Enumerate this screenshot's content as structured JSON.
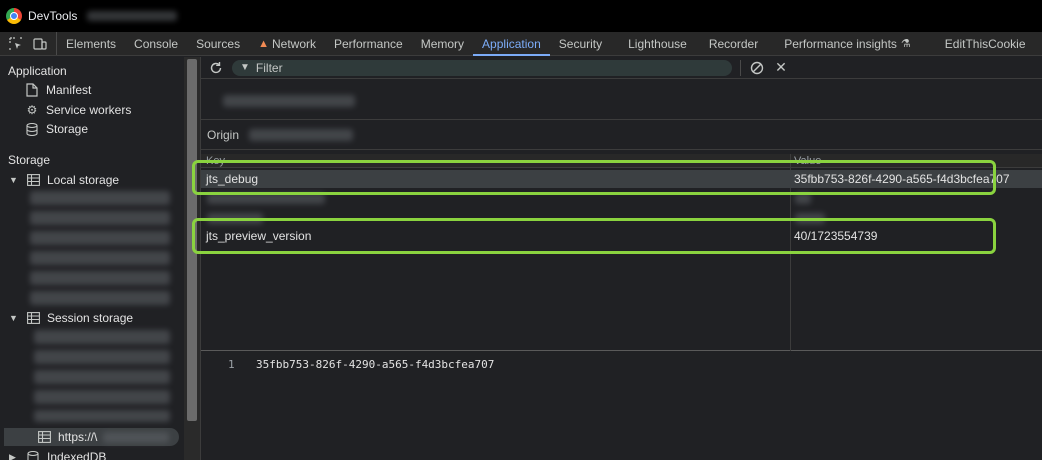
{
  "window": {
    "title": "DevTools"
  },
  "tabs": [
    {
      "label": "Elements"
    },
    {
      "label": "Console"
    },
    {
      "label": "Sources"
    },
    {
      "label": "Network",
      "warning": true
    },
    {
      "label": "Performance"
    },
    {
      "label": "Memory"
    },
    {
      "label": "Application",
      "active": true
    },
    {
      "label": "Security"
    },
    {
      "label": "Lighthouse"
    },
    {
      "label": "Recorder"
    },
    {
      "label": "Performance insights",
      "flask": true
    },
    {
      "label": "EditThisCookie"
    }
  ],
  "sidebar": {
    "application_heading": "Application",
    "manifest": "Manifest",
    "service_workers": "Service workers",
    "storage_item": "Storage",
    "storage_heading": "Storage",
    "local_storage": "Local storage",
    "session_storage": "Session storage",
    "selected_origin": "https://\\",
    "indexeddb": "IndexedDB"
  },
  "toolbar": {
    "filter_placeholder": "Filter"
  },
  "origin": {
    "label": "Origin"
  },
  "grid": {
    "key_header": "Key",
    "value_header": "Value",
    "rows": [
      {
        "key": "jts_debug",
        "value": "35fbb753-826f-4290-a565-f4d3bcfea707"
      },
      {
        "key": "jts_preview_version",
        "value": "40/1723554739"
      }
    ]
  },
  "preview": {
    "line_number": "1",
    "content": "35fbb753-826f-4290-a565-f4d3bcfea707"
  },
  "colors": {
    "accent": "#7cacf8",
    "highlight": "#8ad33f",
    "warning": "#f28b54"
  }
}
